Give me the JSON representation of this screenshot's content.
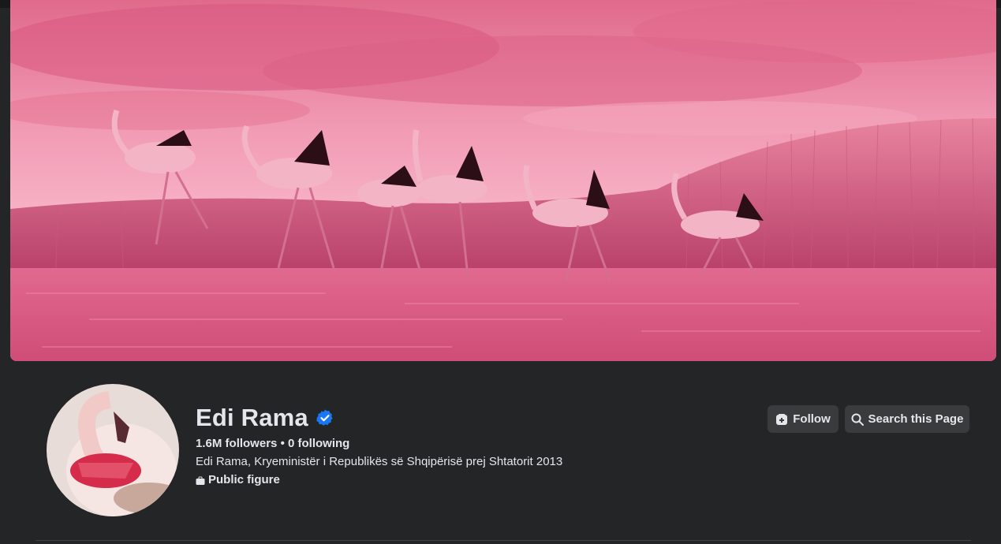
{
  "page": {
    "name": "Edi Rama",
    "verified": true,
    "followers_count": "1.6M",
    "followers_label": "followers",
    "separator": "•",
    "following_count": "0",
    "following_label": "following",
    "bio": "Edi Rama, Kryeministër i Republikës së Shqipërisë prej Shtatorit 2013",
    "category": "Public figure"
  },
  "actions": {
    "follow_label": "Follow",
    "search_label": "Search this Page"
  },
  "icons": {
    "verified": "verified-badge-icon",
    "category": "briefcase-icon",
    "follow": "follow-add-icon",
    "search": "search-icon"
  },
  "colors": {
    "background": "#242526",
    "button": "#3a3b3c",
    "text": "#e4e6eb",
    "verified": "#1877f2",
    "cover_pink": "#e86a8e"
  }
}
